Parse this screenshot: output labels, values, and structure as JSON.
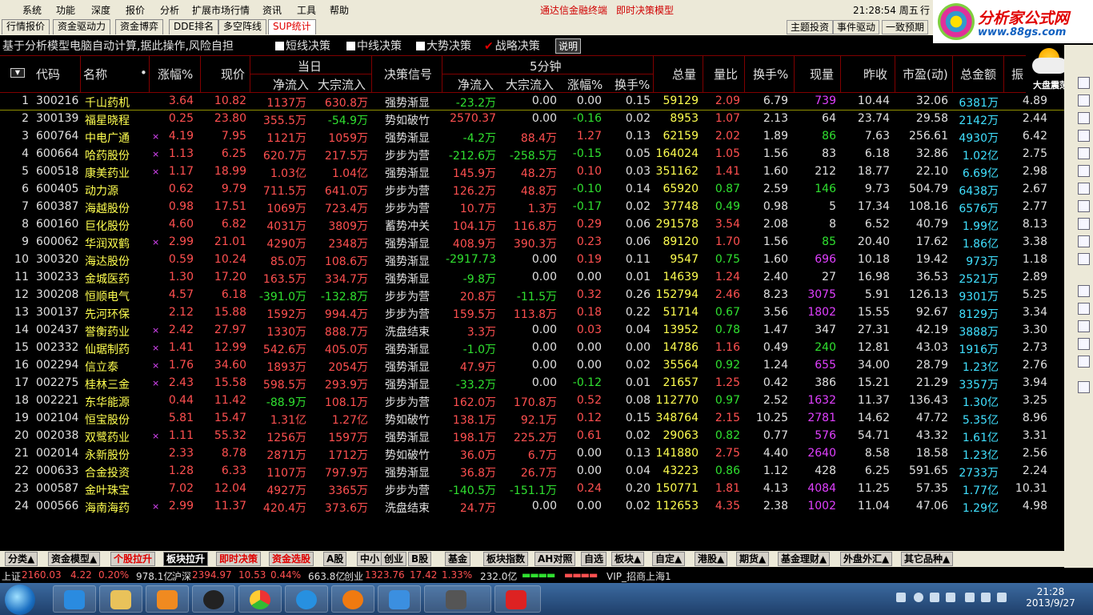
{
  "menubar": {
    "items": [
      "系统",
      "功能",
      "深度",
      "报价",
      "分析",
      "扩展市场行情",
      "资讯",
      "工具",
      "帮助"
    ],
    "center": [
      "通达信金融终端",
      "即时决策模型"
    ],
    "clock": "21:28:54 周五",
    "right_cut": "行"
  },
  "logo": {
    "title": "分析家公式网",
    "url": "www.88gs.com"
  },
  "tabs": {
    "items": [
      "行情报价",
      "资金驱动力",
      "资金博弈",
      "DDE排名",
      "多空阵线",
      "SUP统计"
    ],
    "right": [
      "主题投资",
      "事件驱动",
      "一致预期"
    ]
  },
  "strategy": {
    "lead": "基于分析模型电脑自动计算,据此操作,风险自担",
    "options": [
      "短线决策",
      "中线决策",
      "大势决策",
      "战略决策"
    ],
    "help": "说明"
  },
  "weather": {
    "label": "大盘震荡"
  },
  "header": {
    "sort": "▼",
    "code": "代码",
    "name": "名称",
    "dot": "•",
    "change_pct": "涨幅%",
    "price": "现价",
    "group_today": "当日",
    "net_inflow": "净流入",
    "bulk_inflow": "大宗流入",
    "signal": "决策信号",
    "group_5min": "5分钟",
    "net_inflow_5": "净流入",
    "bulk_inflow_5": "大宗流入",
    "change_pct_5": "涨幅%",
    "turnover_5": "换手%",
    "volume": "总量",
    "vol_ratio": "量比",
    "turnover": "换手%",
    "cur_volume": "现量",
    "prev_close": "昨收",
    "pe": "市盈(动)",
    "amount": "总金额",
    "amp": "振"
  },
  "rows": [
    {
      "i": "1",
      "code": "300216",
      "name": "千山药机",
      "m": "",
      "pct": "3.64",
      "price": "10.82",
      "net": "1137万",
      "bulk": "630.8万",
      "sig": "强势渐显",
      "n5": "-23.2万",
      "b5": "0.00",
      "p5": "0.00",
      "t5": "0.15",
      "vol": "59129",
      "vr": "2.09",
      "to": "6.79",
      "cv": "739",
      "prev": "10.44",
      "pe": "32.06",
      "amt": "6381万",
      "amp": "4.89"
    },
    {
      "i": "2",
      "code": "300139",
      "name": "福星晓程",
      "m": "",
      "pct": "0.25",
      "price": "23.80",
      "net": "355.5万",
      "bulk": "-54.9万",
      "sig": "势如破竹",
      "n5": "2570.37",
      "b5": "0.00",
      "p5": "-0.16",
      "t5": "0.02",
      "vol": "8953",
      "vr": "1.07",
      "to": "2.13",
      "cv": "64",
      "prev": "23.74",
      "pe": "29.58",
      "amt": "2142万",
      "amp": "2.44"
    },
    {
      "i": "3",
      "code": "600764",
      "name": "中电广通",
      "m": "×",
      "pct": "4.19",
      "price": "7.95",
      "net": "1121万",
      "bulk": "1059万",
      "sig": "强势渐显",
      "n5": "-4.2万",
      "b5": "88.4万",
      "p5": "1.27",
      "t5": "0.13",
      "vol": "62159",
      "vr": "2.02",
      "to": "1.89",
      "cv": "86",
      "prev": "7.63",
      "pe": "256.61",
      "amt": "4930万",
      "amp": "6.42"
    },
    {
      "i": "4",
      "code": "600664",
      "name": "哈药股份",
      "m": "×",
      "pct": "1.13",
      "price": "6.25",
      "net": "620.7万",
      "bulk": "217.5万",
      "sig": "步步为营",
      "n5": "-212.6万",
      "b5": "-258.5万",
      "p5": "-0.15",
      "t5": "0.05",
      "vol": "164024",
      "vr": "1.05",
      "to": "1.56",
      "cv": "83",
      "prev": "6.18",
      "pe": "32.86",
      "amt": "1.02亿",
      "amp": "2.75"
    },
    {
      "i": "5",
      "code": "600518",
      "name": "康美药业",
      "m": "×",
      "pct": "1.17",
      "price": "18.99",
      "net": "1.03亿",
      "bulk": "1.04亿",
      "sig": "强势渐显",
      "n5": "145.9万",
      "b5": "48.2万",
      "p5": "0.10",
      "t5": "0.03",
      "vol": "351162",
      "vr": "1.41",
      "to": "1.60",
      "cv": "212",
      "prev": "18.77",
      "pe": "22.10",
      "amt": "6.69亿",
      "amp": "2.98"
    },
    {
      "i": "6",
      "code": "600405",
      "name": "动力源",
      "m": "",
      "pct": "0.62",
      "price": "9.79",
      "net": "711.5万",
      "bulk": "641.0万",
      "sig": "步步为营",
      "n5": "126.2万",
      "b5": "48.8万",
      "p5": "-0.10",
      "t5": "0.14",
      "vol": "65920",
      "vr": "0.87",
      "to": "2.59",
      "cv": "146",
      "prev": "9.73",
      "pe": "504.79",
      "amt": "6438万",
      "amp": "2.67"
    },
    {
      "i": "7",
      "code": "600387",
      "name": "海越股份",
      "m": "",
      "pct": "0.98",
      "price": "17.51",
      "net": "1069万",
      "bulk": "723.4万",
      "sig": "步步为营",
      "n5": "10.7万",
      "b5": "1.3万",
      "p5": "-0.17",
      "t5": "0.02",
      "vol": "37748",
      "vr": "0.49",
      "to": "0.98",
      "cv": "5",
      "prev": "17.34",
      "pe": "108.16",
      "amt": "6576万",
      "amp": "2.77"
    },
    {
      "i": "8",
      "code": "600160",
      "name": "巨化股份",
      "m": "",
      "pct": "4.60",
      "price": "6.82",
      "net": "4031万",
      "bulk": "3809万",
      "sig": "蓄势冲关",
      "n5": "104.1万",
      "b5": "116.8万",
      "p5": "0.29",
      "t5": "0.06",
      "vol": "291578",
      "vr": "3.54",
      "to": "2.08",
      "cv": "8",
      "prev": "6.52",
      "pe": "40.79",
      "amt": "1.99亿",
      "amp": "8.13"
    },
    {
      "i": "9",
      "code": "600062",
      "name": "华润双鹤",
      "m": "×",
      "pct": "2.99",
      "price": "21.01",
      "net": "4290万",
      "bulk": "2348万",
      "sig": "强势渐显",
      "n5": "408.9万",
      "b5": "390.3万",
      "p5": "0.23",
      "t5": "0.06",
      "vol": "89120",
      "vr": "1.70",
      "to": "1.56",
      "cv": "85",
      "prev": "20.40",
      "pe": "17.62",
      "amt": "1.86亿",
      "amp": "3.38"
    },
    {
      "i": "10",
      "code": "300320",
      "name": "海达股份",
      "m": "",
      "pct": "0.59",
      "price": "10.24",
      "net": "85.0万",
      "bulk": "108.6万",
      "sig": "强势渐显",
      "n5": "-2917.73",
      "b5": "0.00",
      "p5": "0.19",
      "t5": "0.11",
      "vol": "9547",
      "vr": "0.75",
      "to": "1.60",
      "cv": "696",
      "prev": "10.18",
      "pe": "19.42",
      "amt": "973万",
      "amp": "1.18"
    },
    {
      "i": "11",
      "code": "300233",
      "name": "金城医药",
      "m": "",
      "pct": "1.30",
      "price": "17.20",
      "net": "163.5万",
      "bulk": "334.7万",
      "sig": "强势渐显",
      "n5": "-9.8万",
      "b5": "0.00",
      "p5": "0.00",
      "t5": "0.01",
      "vol": "14639",
      "vr": "1.24",
      "to": "2.40",
      "cv": "27",
      "prev": "16.98",
      "pe": "36.53",
      "amt": "2521万",
      "amp": "2.89"
    },
    {
      "i": "12",
      "code": "300208",
      "name": "恒顺电气",
      "m": "",
      "pct": "4.57",
      "price": "6.18",
      "net": "-391.0万",
      "bulk": "-132.8万",
      "sig": "步步为营",
      "n5": "20.8万",
      "b5": "-11.5万",
      "p5": "0.32",
      "t5": "0.26",
      "vol": "152794",
      "vr": "2.46",
      "to": "8.23",
      "cv": "3075",
      "prev": "5.91",
      "pe": "126.13",
      "amt": "9301万",
      "amp": "5.25"
    },
    {
      "i": "13",
      "code": "300137",
      "name": "先河环保",
      "m": "",
      "pct": "2.12",
      "price": "15.88",
      "net": "1592万",
      "bulk": "994.4万",
      "sig": "步步为营",
      "n5": "159.5万",
      "b5": "113.8万",
      "p5": "0.18",
      "t5": "0.22",
      "vol": "51714",
      "vr": "0.67",
      "to": "3.56",
      "cv": "1802",
      "prev": "15.55",
      "pe": "92.67",
      "amt": "8129万",
      "amp": "3.34"
    },
    {
      "i": "14",
      "code": "002437",
      "name": "誉衡药业",
      "m": "×",
      "pct": "2.42",
      "price": "27.97",
      "net": "1330万",
      "bulk": "888.7万",
      "sig": "洗盘结束",
      "n5": "3.3万",
      "b5": "0.00",
      "p5": "0.03",
      "t5": "0.04",
      "vol": "13952",
      "vr": "0.78",
      "to": "1.47",
      "cv": "347",
      "prev": "27.31",
      "pe": "42.19",
      "amt": "3888万",
      "amp": "3.30"
    },
    {
      "i": "15",
      "code": "002332",
      "name": "仙琚制药",
      "m": "×",
      "pct": "1.41",
      "price": "12.99",
      "net": "542.6万",
      "bulk": "405.0万",
      "sig": "强势渐显",
      "n5": "-1.0万",
      "b5": "0.00",
      "p5": "0.00",
      "t5": "0.00",
      "vol": "14786",
      "vr": "1.16",
      "to": "0.49",
      "cv": "240",
      "prev": "12.81",
      "pe": "43.03",
      "amt": "1916万",
      "amp": "2.73"
    },
    {
      "i": "16",
      "code": "002294",
      "name": "信立泰",
      "m": "×",
      "pct": "1.76",
      "price": "34.60",
      "net": "1893万",
      "bulk": "2054万",
      "sig": "强势渐显",
      "n5": "47.9万",
      "b5": "0.00",
      "p5": "0.00",
      "t5": "0.02",
      "vol": "35564",
      "vr": "0.92",
      "to": "1.24",
      "cv": "655",
      "prev": "34.00",
      "pe": "28.79",
      "amt": "1.23亿",
      "amp": "2.76"
    },
    {
      "i": "17",
      "code": "002275",
      "name": "桂林三金",
      "m": "×",
      "pct": "2.43",
      "price": "15.58",
      "net": "598.5万",
      "bulk": "293.9万",
      "sig": "强势渐显",
      "n5": "-33.2万",
      "b5": "0.00",
      "p5": "-0.12",
      "t5": "0.01",
      "vol": "21657",
      "vr": "1.25",
      "to": "0.42",
      "cv": "386",
      "prev": "15.21",
      "pe": "21.29",
      "amt": "3357万",
      "amp": "3.94"
    },
    {
      "i": "18",
      "code": "002221",
      "name": "东华能源",
      "m": "",
      "pct": "0.44",
      "price": "11.42",
      "net": "-88.9万",
      "bulk": "108.1万",
      "sig": "步步为营",
      "n5": "162.0万",
      "b5": "170.8万",
      "p5": "0.52",
      "t5": "0.08",
      "vol": "112770",
      "vr": "0.97",
      "to": "2.52",
      "cv": "1632",
      "prev": "11.37",
      "pe": "136.43",
      "amt": "1.30亿",
      "amp": "3.25"
    },
    {
      "i": "19",
      "code": "002104",
      "name": "恒宝股份",
      "m": "",
      "pct": "5.81",
      "price": "15.47",
      "net": "1.31亿",
      "bulk": "1.27亿",
      "sig": "势如破竹",
      "n5": "138.1万",
      "b5": "92.1万",
      "p5": "0.12",
      "t5": "0.15",
      "vol": "348764",
      "vr": "2.15",
      "to": "10.25",
      "cv": "2781",
      "prev": "14.62",
      "pe": "47.72",
      "amt": "5.35亿",
      "amp": "8.96"
    },
    {
      "i": "20",
      "code": "002038",
      "name": "双鹭药业",
      "m": "×",
      "pct": "1.11",
      "price": "55.32",
      "net": "1256万",
      "bulk": "1597万",
      "sig": "强势渐显",
      "n5": "198.1万",
      "b5": "225.2万",
      "p5": "0.61",
      "t5": "0.02",
      "vol": "29063",
      "vr": "0.82",
      "to": "0.77",
      "cv": "576",
      "prev": "54.71",
      "pe": "43.32",
      "amt": "1.61亿",
      "amp": "3.31"
    },
    {
      "i": "21",
      "code": "002014",
      "name": "永新股份",
      "m": "",
      "pct": "2.33",
      "price": "8.78",
      "net": "2871万",
      "bulk": "1712万",
      "sig": "势如破竹",
      "n5": "36.0万",
      "b5": "6.7万",
      "p5": "0.00",
      "t5": "0.13",
      "vol": "141880",
      "vr": "2.75",
      "to": "4.40",
      "cv": "2640",
      "prev": "8.58",
      "pe": "18.58",
      "amt": "1.23亿",
      "amp": "2.56"
    },
    {
      "i": "22",
      "code": "000633",
      "name": "合金投资",
      "m": "",
      "pct": "1.28",
      "price": "6.33",
      "net": "1107万",
      "bulk": "797.9万",
      "sig": "强势渐显",
      "n5": "36.8万",
      "b5": "26.7万",
      "p5": "0.00",
      "t5": "0.04",
      "vol": "43223",
      "vr": "0.86",
      "to": "1.12",
      "cv": "428",
      "prev": "6.25",
      "pe": "591.65",
      "amt": "2733万",
      "amp": "2.24"
    },
    {
      "i": "23",
      "code": "000587",
      "name": "金叶珠宝",
      "m": "",
      "pct": "7.02",
      "price": "12.04",
      "net": "4927万",
      "bulk": "3365万",
      "sig": "步步为营",
      "n5": "-140.5万",
      "b5": "-151.1万",
      "p5": "0.24",
      "t5": "0.20",
      "vol": "150771",
      "vr": "1.81",
      "to": "4.13",
      "cv": "4084",
      "prev": "11.25",
      "pe": "57.35",
      "amt": "1.77亿",
      "amp": "10.31"
    },
    {
      "i": "24",
      "code": "000566",
      "name": "海南海药",
      "m": "×",
      "pct": "2.99",
      "price": "11.37",
      "net": "420.4万",
      "bulk": "373.6万",
      "sig": "洗盘结束",
      "n5": "24.7万",
      "b5": "0.00",
      "p5": "0.00",
      "t5": "0.02",
      "vol": "112653",
      "vr": "4.35",
      "to": "2.38",
      "cv": "1002",
      "prev": "11.04",
      "pe": "47.06",
      "amt": "1.29亿",
      "amp": "4.98"
    }
  ],
  "catbar": [
    "分类▲",
    "资金模型▲",
    "个股拉升",
    "板块拉升",
    "即时决策",
    "资金选股",
    "A股",
    "中小",
    "创业",
    "B股",
    "基金",
    "板块指数",
    "AH对照",
    "自选",
    "板块▲",
    "自定▲",
    "港股▲",
    "期货▲",
    "基金理财▲",
    "外盘外汇▲",
    "其它品种▲"
  ],
  "indexbar": {
    "sh_label": "上证",
    "sh_val": "2160.03",
    "sh_chg": "4.22",
    "sh_pct": "0.20%",
    "sh_amt": "978.1亿",
    "hs_label": "沪深",
    "hs_val": "2394.97",
    "hs_chg": "10.53",
    "hs_pct": "0.44%",
    "hs_amt": "663.8亿",
    "cy_label": "创业",
    "cy_val": "1323.76",
    "cy_chg": "17.42",
    "cy_pct": "1.33%",
    "cy_amt": "232.0亿",
    "server": "VIP_招商上海1"
  },
  "taskbar": {
    "time": "21:28",
    "date": "2013/9/27"
  }
}
